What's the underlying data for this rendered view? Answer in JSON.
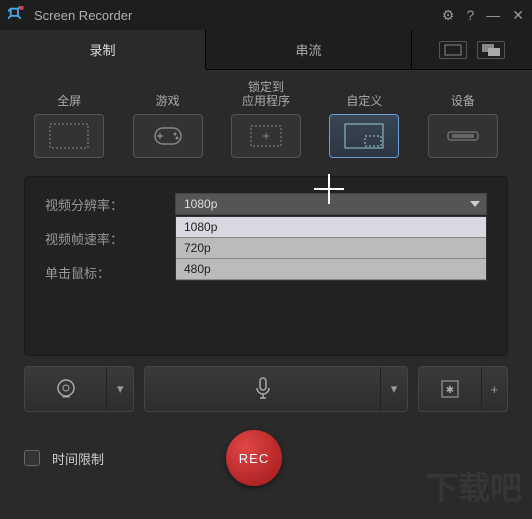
{
  "titlebar": {
    "app_name": "Screen Recorder"
  },
  "tabs": {
    "record": "录制",
    "stream": "串流"
  },
  "modes": {
    "fullscreen": "全屏",
    "game": "游戏",
    "lock_app": "锁定到\n应用程序",
    "custom": "自定义",
    "device": "设备"
  },
  "settings": {
    "resolution_label": "视频分辨率：",
    "framerate_label": "视频帧速率：",
    "click_label": "单击鼠标：",
    "resolution_value": "1080p",
    "resolution_options": [
      "1080p",
      "720p",
      "480p"
    ]
  },
  "bottom": {
    "time_limit": "时间限制",
    "rec": "REC"
  },
  "watermark": "下载吧"
}
